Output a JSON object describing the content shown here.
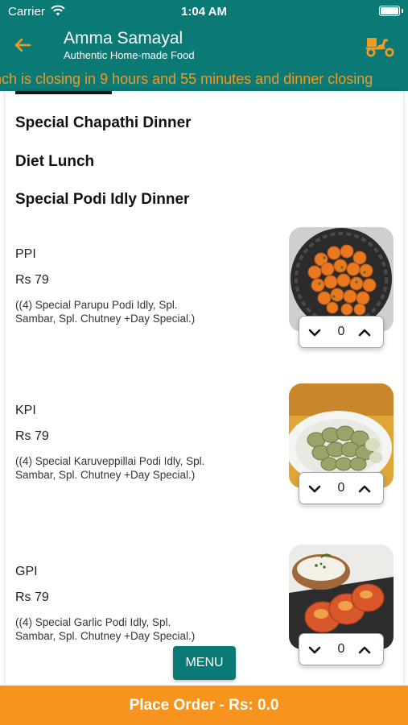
{
  "status_bar": {
    "carrier": "Carrier",
    "time": "1:04 AM"
  },
  "header": {
    "title": "Amma Samayal",
    "subtitle": "Authentic Home-made Food"
  },
  "ticker": {
    "text": "nch is closing in 9 hours and 55 minutes and dinner closing"
  },
  "categories": [
    "Special Chapathi Dinner",
    "Diet Lunch",
    "Special Podi Idly Dinner"
  ],
  "items": [
    {
      "name": "PPI",
      "price": "Rs 79",
      "description": "((4) Special Parupu Podi Idly, Spl. Sambar, Spl. Chutney +Day Special.)",
      "quantity": "0"
    },
    {
      "name": "KPI",
      "price": "Rs 79",
      "description": "((4) Special Karuveppillai Podi Idly, Spl. Sambar, Spl. Chutney +Day Special.)",
      "quantity": "0"
    },
    {
      "name": "GPI",
      "price": "Rs 79",
      "description": "((4) Special Garlic Podi Idly, Spl. Sambar, Spl. Chutney +Day Special.)",
      "quantity": "0"
    }
  ],
  "menu_button": {
    "label": "MENU"
  },
  "place_order": {
    "label": "Place Order - Rs: 0.0"
  },
  "icons": {
    "back": "arrow-left-icon",
    "delivery": "scooter-icon",
    "decrement": "chevron-down-icon",
    "increment": "chevron-up-icon"
  },
  "colors": {
    "primary": "#0b7a75",
    "accent": "#f7941d",
    "ticker_text": "#f29a22"
  }
}
